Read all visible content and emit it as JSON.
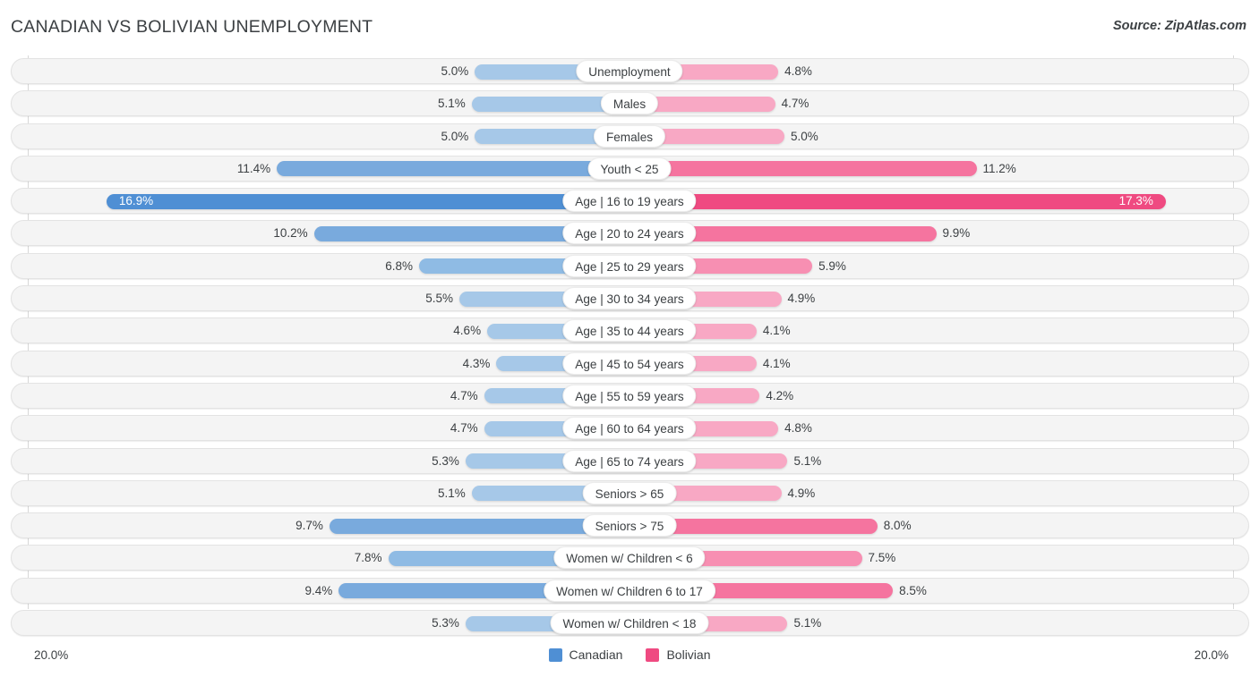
{
  "header": {
    "title": "CANADIAN VS BOLIVIAN UNEMPLOYMENT",
    "source": "Source: ZipAtlas.com"
  },
  "footer": {
    "axis_min_label": "20.0%",
    "axis_max_label": "20.0%",
    "legend": [
      {
        "label": "Canadian",
        "color": "#4f8fd4",
        "icon": "square-swatch-icon"
      },
      {
        "label": "Bolivian",
        "color": "#ef4a81",
        "icon": "square-swatch-icon"
      }
    ]
  },
  "chart_data": {
    "type": "bar",
    "subtype": "diverging-horizontal-bar",
    "title": "CANADIAN VS BOLIVIAN UNEMPLOYMENT",
    "xlabel": "",
    "ylabel": "",
    "axis_max": 20.0,
    "axis_min": 20.0,
    "unit": "%",
    "grid": true,
    "legend_position": "bottom-center",
    "categories": [
      "Unemployment",
      "Males",
      "Females",
      "Youth < 25",
      "Age | 16 to 19 years",
      "Age | 20 to 24 years",
      "Age | 25 to 29 years",
      "Age | 30 to 34 years",
      "Age | 35 to 44 years",
      "Age | 45 to 54 years",
      "Age | 55 to 59 years",
      "Age | 60 to 64 years",
      "Age | 65 to 74 years",
      "Seniors > 65",
      "Seniors > 75",
      "Women w/ Children < 6",
      "Women w/ Children 6 to 17",
      "Women w/ Children < 18"
    ],
    "series": [
      {
        "name": "Canadian",
        "side": "left",
        "color": "#4f8fd4",
        "values": [
          5.0,
          5.1,
          5.0,
          11.4,
          16.9,
          10.2,
          6.8,
          5.5,
          4.6,
          4.3,
          4.7,
          4.7,
          5.3,
          5.1,
          9.7,
          7.8,
          9.4,
          5.3
        ],
        "labels": [
          "5.0%",
          "5.1%",
          "5.0%",
          "11.4%",
          "16.9%",
          "10.2%",
          "6.8%",
          "5.5%",
          "4.6%",
          "4.3%",
          "4.7%",
          "4.7%",
          "5.3%",
          "5.1%",
          "9.7%",
          "7.8%",
          "9.4%",
          "5.3%"
        ]
      },
      {
        "name": "Bolivian",
        "side": "right",
        "color": "#ef4a81",
        "values": [
          4.8,
          4.7,
          5.0,
          11.2,
          17.3,
          9.9,
          5.9,
          4.9,
          4.1,
          4.1,
          4.2,
          4.8,
          5.1,
          4.9,
          8.0,
          7.5,
          8.5,
          5.1
        ],
        "labels": [
          "4.8%",
          "4.7%",
          "5.0%",
          "11.2%",
          "17.3%",
          "9.9%",
          "5.9%",
          "4.9%",
          "4.1%",
          "4.1%",
          "4.2%",
          "4.8%",
          "5.1%",
          "4.9%",
          "8.0%",
          "7.5%",
          "8.5%",
          "5.1%"
        ]
      }
    ]
  }
}
